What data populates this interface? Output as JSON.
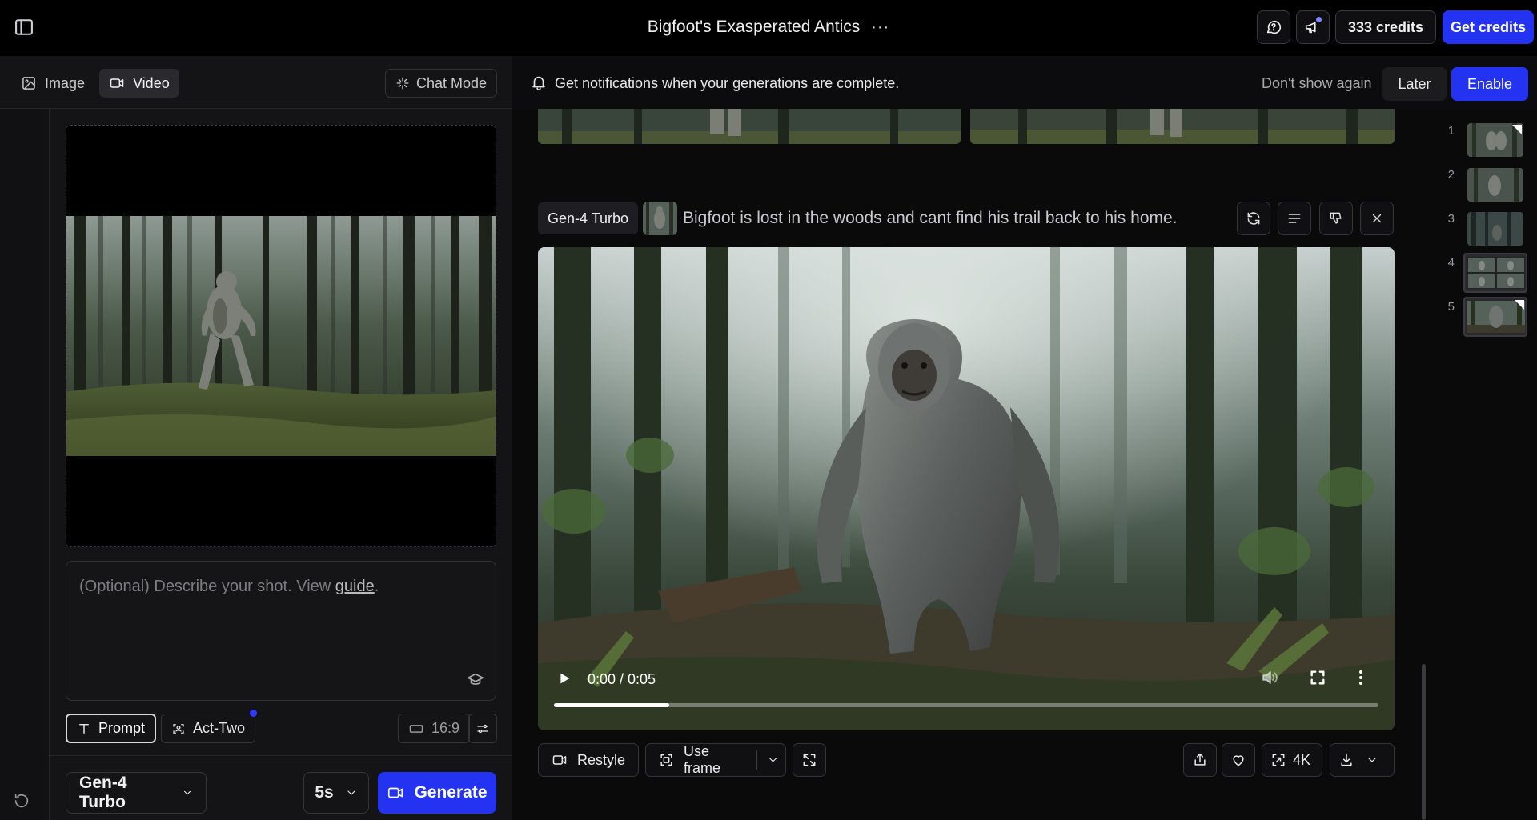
{
  "topbar": {
    "title": "Bigfoot's Exasperated Antics",
    "more": "···",
    "credits": "333 credits",
    "get_credits": "Get credits"
  },
  "modes": {
    "image": "Image",
    "video": "Video",
    "chat_mode": "Chat Mode"
  },
  "prompt": {
    "placeholder": "(Optional) Describe your shot. View ",
    "guide_link": "guide",
    "period": "."
  },
  "chips": {
    "prompt": "Prompt",
    "act_two": "Act-Two",
    "ratio": "16:9"
  },
  "controls": {
    "model": "Gen-4 Turbo",
    "duration": "5s",
    "generate": "Generate"
  },
  "notification": {
    "text": "Get notifications when your generations are complete.",
    "dont_show": "Don't show again",
    "later": "Later",
    "enable": "Enable"
  },
  "generation": {
    "model": "Gen-4 Turbo",
    "prompt": "Bigfoot is lost in the woods and cant find his trail back to his home.",
    "time": "0:00 / 0:05",
    "progress": 0.14
  },
  "actions": {
    "restyle": "Restyle",
    "use_frame": "Use frame",
    "upscale": "4K"
  },
  "thumbnails": [
    "1",
    "2",
    "3",
    "4",
    "5"
  ],
  "colors": {
    "accent": "#2433f1",
    "background": "#0a0a0b",
    "panel": "#141416"
  }
}
